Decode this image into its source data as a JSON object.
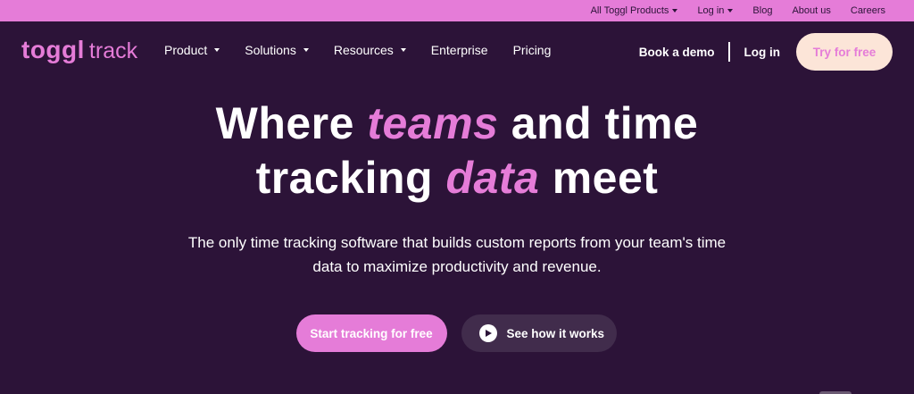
{
  "topbar": {
    "items": [
      {
        "label": "All Toggl Products",
        "dropdown": true
      },
      {
        "label": "Log in",
        "dropdown": true
      },
      {
        "label": "Blog",
        "dropdown": false
      },
      {
        "label": "About us",
        "dropdown": false
      },
      {
        "label": "Careers",
        "dropdown": false
      }
    ]
  },
  "logo": {
    "mark": "toggl",
    "product": "track"
  },
  "nav": {
    "items": [
      {
        "label": "Product",
        "dropdown": true
      },
      {
        "label": "Solutions",
        "dropdown": true
      },
      {
        "label": "Resources",
        "dropdown": true
      },
      {
        "label": "Enterprise",
        "dropdown": false
      },
      {
        "label": "Pricing",
        "dropdown": false
      }
    ],
    "book_demo": "Book a demo",
    "login": "Log in",
    "try_free": "Try for free"
  },
  "hero": {
    "line1_pre": "Where ",
    "line1_accent": "teams",
    "line1_post": " and time",
    "line2_pre": "tracking ",
    "line2_accent": "data",
    "line2_post": " meet",
    "subtitle_line1": "The only time tracking software that builds custom reports from your team's time",
    "subtitle_line2": "data to maximize productivity and revenue.",
    "cta_primary": "Start tracking for free",
    "cta_secondary": "See how it works"
  },
  "colors": {
    "background": "#2c1338",
    "accent_pink": "#e57cd8",
    "peach": "#fce5d8"
  },
  "icons": [
    "caret-down-icon",
    "play-icon"
  ]
}
